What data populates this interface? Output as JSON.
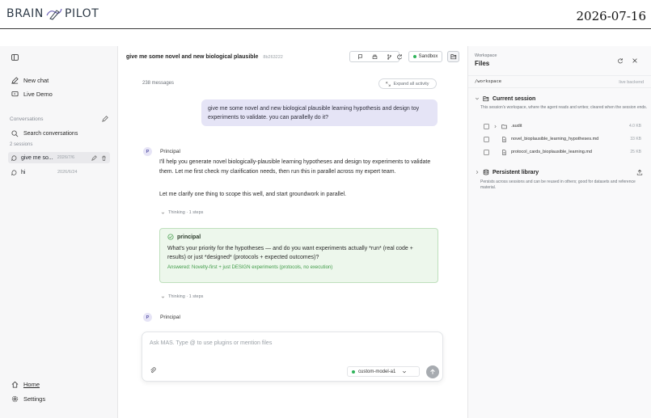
{
  "header": {
    "logo_left": "BRAIN",
    "logo_right": "PILOT",
    "date": "2026-07-16"
  },
  "sidebar": {
    "new_chat": "New chat",
    "live_demo": "Live Demo",
    "conversations_label": "Conversations",
    "search": "Search conversations",
    "sessions_count": "2 sessions",
    "sessions": [
      {
        "title": "give me so...",
        "date": "2026/7/6"
      },
      {
        "title": "hi",
        "date": "2026/6/24"
      }
    ],
    "home": "Home",
    "settings": "Settings"
  },
  "chat": {
    "title": "give me some novel and new biological plausible",
    "id": "8b263222",
    "sandbox": "Sandbox",
    "messages_count": "238 messages",
    "expand_all": "Expand all activity",
    "user_message": "give me some novel and new biological plausible learning hypothesis and design toy experiments to validate. you can parallelly do it?",
    "agent_avatar": "P",
    "agent_name": "Principal",
    "agent_reply_1": "I'll help you generate novel biologically-plausible learning hypotheses and design toy experiments to validate them. Let me first check my clarification needs, then run this in parallel across my expert team.",
    "agent_reply_2": "Let me clarify one thing to scope this well, and start groundwork in parallel.",
    "thinking_1": "Thinking · 1 steps",
    "question_card": {
      "title": "principal",
      "question": "What's your priority for the hypotheses — and do you want experiments actually *run* (real code + results) or just *designed* (protocols + expected outcomes)?",
      "answer": "Answered: Novelty-first + just DESIGN experiments (protocols, no execution)"
    },
    "thinking_2": "Thinking · 1 steps",
    "agent_name_2": "Principal"
  },
  "composer": {
    "placeholder": "Ask MAS. Type @ to use plugins or mention files",
    "model": "custom-model-a1"
  },
  "workspace": {
    "label": "Workspace",
    "title": "Files",
    "path": "/workspace",
    "backend": "live backend",
    "current_session": {
      "title": "Current session",
      "desc": "This session's workspace, where the agent reads and writes; cleared when the session ends.",
      "files": [
        {
          "name": ".audit",
          "size": "4.0 KB",
          "type": "folder"
        },
        {
          "name": "novel_bioplausible_learning_hypotheses.md",
          "size": "33 KB",
          "type": "file"
        },
        {
          "name": "protocol_cards_bioplausible_learning.md",
          "size": "25 KB",
          "type": "file"
        }
      ]
    },
    "persistent": {
      "title": "Persistent library",
      "desc": "Persists across sessions and can be reused in others; good for datasets and reference material."
    }
  },
  "colors": {
    "user_bubble": "#e5e4f6",
    "answer_green": "#3e9a46",
    "status_green": "#2fb35a"
  }
}
